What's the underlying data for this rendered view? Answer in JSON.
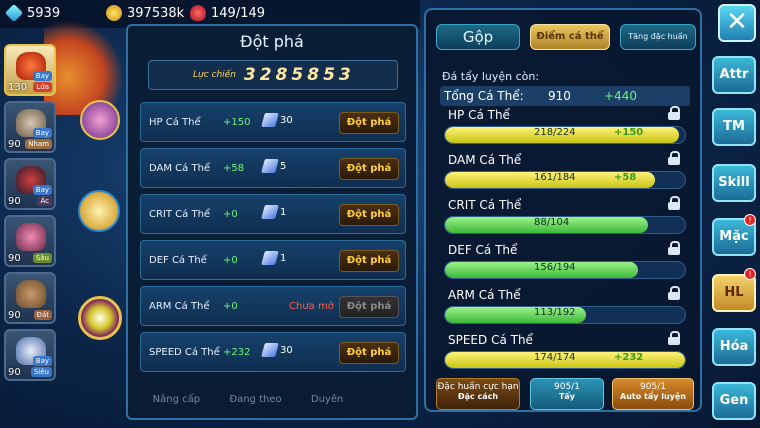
{
  "resources": {
    "gems": "5939",
    "coins": "397538k",
    "stamina": "149/149"
  },
  "team": [
    {
      "level": "130",
      "tags": [
        "Bay",
        "Lửa"
      ],
      "active": true
    },
    {
      "level": "90",
      "tags": [
        "Bay",
        "Nham"
      ],
      "active": false
    },
    {
      "level": "90",
      "tags": [
        "Bay",
        "Ác"
      ],
      "active": false
    },
    {
      "level": "90",
      "tags": [
        "Sâu"
      ],
      "active": false
    },
    {
      "level": "90",
      "tags": [
        "Đất"
      ],
      "active": false
    },
    {
      "level": "90",
      "tags": [
        "Bay",
        "Siêu"
      ],
      "active": false
    }
  ],
  "breakthrough": {
    "title": "Đột phá",
    "power_label": "Lực chiến",
    "power_value": "3285853",
    "rows": [
      {
        "name": "HP Cá Thể",
        "bonus": "+150",
        "cost": "30",
        "button": "Đột phá"
      },
      {
        "name": "DAM Cá Thể",
        "bonus": "+58",
        "cost": "5",
        "button": "Đột phá"
      },
      {
        "name": "CRIT Cá Thể",
        "bonus": "+0",
        "cost": "1",
        "button": "Đột phá"
      },
      {
        "name": "DEF Cá Thể",
        "bonus": "+0",
        "cost": "1",
        "button": "Đột phá"
      },
      {
        "name": "ARM Cá Thể",
        "bonus": "+0",
        "status": "Chưa mở",
        "button": "Đột phá"
      },
      {
        "name": "SPEED Cá Thể",
        "bonus": "+232",
        "cost": "30",
        "button": "Đột phá"
      }
    ],
    "bottom_tabs": [
      "Nâng cấp",
      "Đang theo",
      "Duyên"
    ]
  },
  "right": {
    "tabs": [
      "Gộp",
      "Điểm cá thể",
      "Tăng đặc huấn"
    ],
    "subtitle": "Đá tẩy luyện còn:",
    "total_label": "Tổng Cá Thể:",
    "total_value": "910",
    "total_plus": "+440",
    "stats": [
      {
        "name": "HP Cá Thể",
        "value": "218/224",
        "plus": "+150",
        "current": 218,
        "max": 224,
        "color": "yellow"
      },
      {
        "name": "DAM Cá Thể",
        "value": "161/184",
        "plus": "+58",
        "current": 161,
        "max": 184,
        "color": "yellow"
      },
      {
        "name": "CRIT Cá Thể",
        "value": "88/104",
        "plus": "",
        "current": 88,
        "max": 104,
        "color": "green"
      },
      {
        "name": "DEF Cá Thể",
        "value": "156/194",
        "plus": "",
        "current": 156,
        "max": 194,
        "color": "green"
      },
      {
        "name": "ARM Cá Thể",
        "value": "113/192",
        "plus": "",
        "current": 113,
        "max": 192,
        "color": "green"
      },
      {
        "name": "SPEED Cá Thể",
        "value": "174/174",
        "plus": "+232",
        "current": 174,
        "max": 174,
        "color": "yellow"
      }
    ],
    "buttons": [
      {
        "line1": "Đặc huấn cực hạn",
        "line2": "Đặc cách"
      },
      {
        "line1": "905/1",
        "line2": "Tẩy"
      },
      {
        "line1": "905/1",
        "line2": "Auto tẩy luyện"
      }
    ]
  },
  "side_menu": [
    "Attr",
    "TM",
    "Skill",
    "Mặc",
    "HL",
    "Hóa",
    "Gen"
  ],
  "close_label": "✕"
}
